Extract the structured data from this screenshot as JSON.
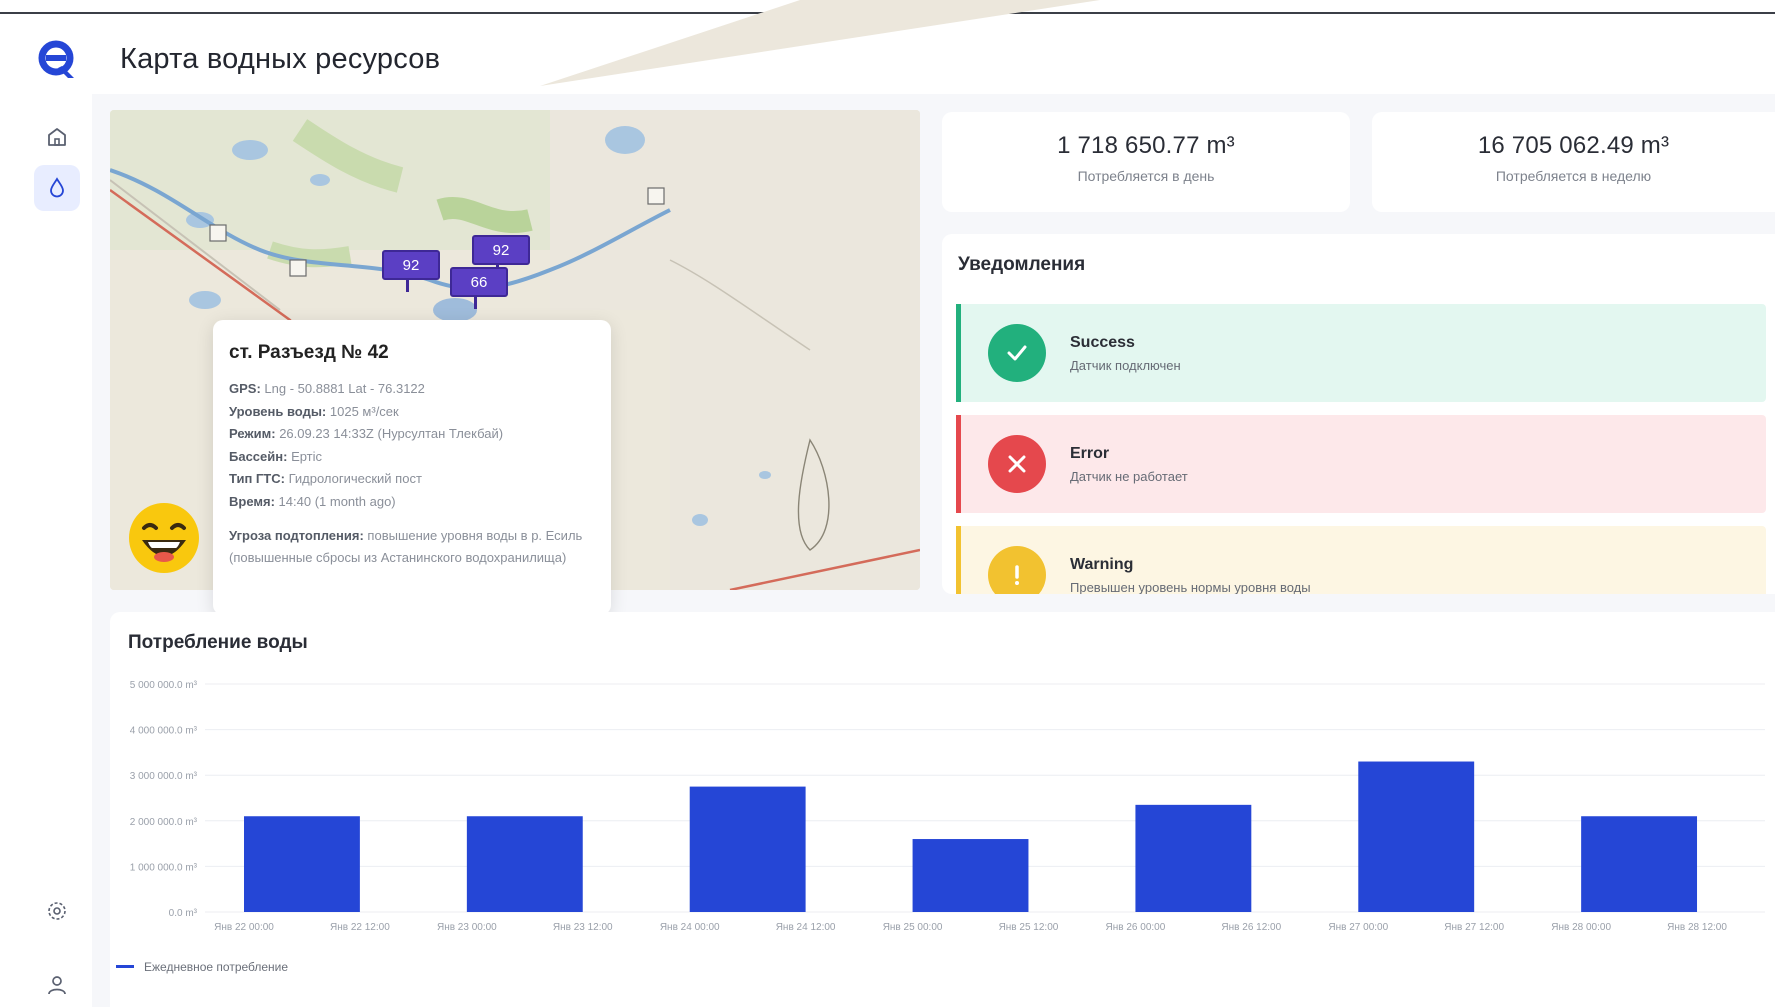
{
  "app": {
    "title": "Карта водных ресурсов"
  },
  "sidebar": {
    "logo_icon": "logo-icon",
    "items": [
      {
        "icon": "home-icon",
        "active": false
      },
      {
        "icon": "water-drop-icon",
        "active": true
      }
    ],
    "bottom_items": [
      {
        "icon": "gear-icon"
      },
      {
        "icon": "user-icon"
      }
    ]
  },
  "map": {
    "pins": [
      "92",
      "92",
      "66"
    ],
    "popup": {
      "title": "ст. Разъезд № 42",
      "rows": [
        {
          "label": "GPS:",
          "value": "Lng - 50.8881 Lat - 76.3122"
        },
        {
          "label": "Уровень воды:",
          "value": "1025 м³/сек"
        },
        {
          "label": "Режим:",
          "value": "26.09.23 14:33Z (Нурсултан Тлекбай)"
        },
        {
          "label": "Бассейн:",
          "value": "Ертіс"
        },
        {
          "label": "Тип ГТС:",
          "value": "Гидрологический пост"
        },
        {
          "label": "Время:",
          "value": "14:40 (1 month ago)"
        }
      ],
      "threat_label": "Угроза подтопления:",
      "threat_value": "повышение уровня воды в р. Есиль (повышенные сбросы из Астанинского водохранилища)"
    }
  },
  "stats": [
    {
      "value": "1 718 650.77 m³",
      "label": "Потребляется в день"
    },
    {
      "value": "16 705 062.49 m³",
      "label": "Потребляется в неделю"
    }
  ],
  "notifications": {
    "title": "Уведомления",
    "items": [
      {
        "type": "success",
        "title": "Success",
        "text": "Датчик подключен",
        "bg": "#e3f7f0",
        "accent": "#22b07d"
      },
      {
        "type": "error",
        "title": "Error",
        "text": "Датчик не работает",
        "bg": "#fde8ea",
        "accent": "#e5484d"
      },
      {
        "type": "warning",
        "title": "Warning",
        "text": "Превышен уровень нормы уровня воды",
        "bg": "#fdf6e3",
        "accent": "#f2c230"
      }
    ]
  },
  "chart_data": {
    "type": "bar",
    "title": "Потребление воды",
    "y_ticks": [
      "0.0 m³",
      "1 000 000.0 m³",
      "2 000 000.0 m³",
      "3 000 000.0 m³",
      "4 000 000.0 m³",
      "5 000 000.0 m³"
    ],
    "ylim": [
      0,
      5000000
    ],
    "x_ticks": [
      "Янв 22 00:00",
      "Янв 22 12:00",
      "Янв 23 00:00",
      "Янв 23 12:00",
      "Янв 24 00:00",
      "Янв 24 12:00",
      "Янв 25 00:00",
      "Янв 25 12:00",
      "Янв 26 00:00",
      "Янв 26 12:00",
      "Янв 27 00:00",
      "Янв 27 12:00",
      "Янв 28 00:00",
      "Янв 28 12:00"
    ],
    "values": [
      2100000,
      2100000,
      2750000,
      1600000,
      2350000,
      3300000,
      2100000
    ],
    "series": [
      {
        "name": "Ежедневное потребление",
        "color": "#2546d6"
      }
    ],
    "legend_position": "bottom-left",
    "grid": true
  }
}
